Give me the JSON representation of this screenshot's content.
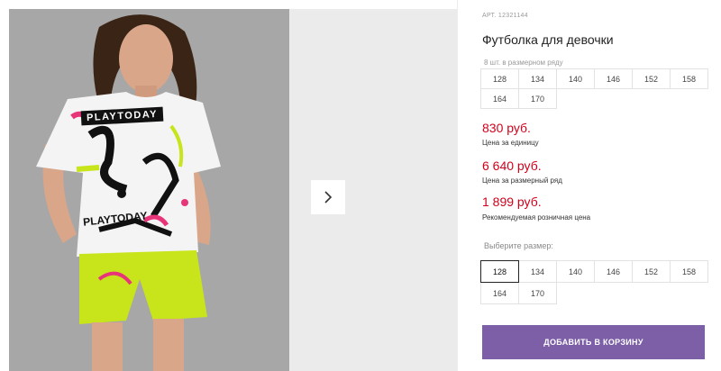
{
  "gallery": {
    "photo_alt": "Девочка в футболке PLAYTODAY",
    "shirt_print_1": "PLAYTODAY",
    "shirt_print_2": "PLAYTODAY",
    "next_icon": "chevron-right-icon",
    "colors": {
      "photo_bg": "#a7a7a7",
      "next_bg": "#ebebeb",
      "shorts": "#c8e41a"
    }
  },
  "product": {
    "article": "АРТ. 12321144",
    "title": "Футболка для девочки",
    "sizes_note": "8 шт. в размерном ряду",
    "size_range": [
      "128",
      "134",
      "140",
      "146",
      "152",
      "158",
      "164",
      "170"
    ],
    "price_unit": "830 руб.",
    "price_unit_note": "Цена за единицу",
    "price_range": "6 640 руб.",
    "price_range_note": "Цена за размерный ряд",
    "price_retail": "1 899 руб.",
    "price_retail_note": "Рекомендуемая розничная цена",
    "choose_size_label": "Выберите размер:",
    "size_options": [
      "128",
      "134",
      "140",
      "146",
      "152",
      "158",
      "164",
      "170"
    ],
    "selected_size": "128",
    "add_to_cart": "Добавить в корзину",
    "colors": {
      "price": "#d0021b",
      "button": "#7c5fa7"
    }
  }
}
